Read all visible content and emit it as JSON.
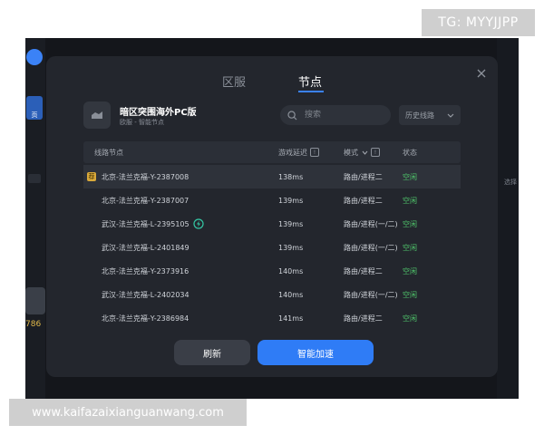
{
  "watermark_top": "TG: MYYJJPP",
  "watermark_bottom": "www.kaifazaixianguanwang.com",
  "background": {
    "home_label": "页",
    "side_number": "786",
    "right_text": "选择"
  },
  "modal": {
    "tabs": [
      {
        "label": "区服",
        "active": false
      },
      {
        "label": "节点",
        "active": true
      }
    ],
    "game": {
      "title": "暗区突围海外PC版",
      "subtitle": "欧服 - 智能节点"
    },
    "search": {
      "placeholder": "搜索",
      "value": ""
    },
    "history_select": {
      "label": "历史线路"
    },
    "table": {
      "headers": {
        "name": "线路节点",
        "latency": "游戏延迟",
        "mode": "模式",
        "status": "状态"
      },
      "rows": [
        {
          "name": "北京-法兰克福-Y-2387008",
          "latency": "138ms",
          "mode": "路由/进程二",
          "status": "空闲",
          "favorite": true,
          "favorite_label": "荐",
          "boost": false
        },
        {
          "name": "北京-法兰克福-Y-2387007",
          "latency": "139ms",
          "mode": "路由/进程二",
          "status": "空闲",
          "favorite": false,
          "boost": false
        },
        {
          "name": "武汉-法兰克福-L-2395105",
          "latency": "139ms",
          "mode": "路由/进程(一/二)",
          "status": "空闲",
          "favorite": false,
          "boost": true
        },
        {
          "name": "武汉-法兰克福-L-2401849",
          "latency": "139ms",
          "mode": "路由/进程(一/二)",
          "status": "空闲",
          "favorite": false,
          "boost": false
        },
        {
          "name": "北京-法兰克福-Y-2373916",
          "latency": "140ms",
          "mode": "路由/进程二",
          "status": "空闲",
          "favorite": false,
          "boost": false
        },
        {
          "name": "武汉-法兰克福-L-2402034",
          "latency": "140ms",
          "mode": "路由/进程(一/二)",
          "status": "空闲",
          "favorite": false,
          "boost": false
        },
        {
          "name": "北京-法兰克福-Y-2386984",
          "latency": "141ms",
          "mode": "路由/进程二",
          "status": "空闲",
          "favorite": false,
          "boost": false
        }
      ]
    },
    "buttons": {
      "refresh": "刷新",
      "accelerate": "智能加速"
    },
    "colors": {
      "accent": "#2f7cf6",
      "status_idle": "#4fc46a",
      "modal_bg": "#23262d"
    }
  }
}
